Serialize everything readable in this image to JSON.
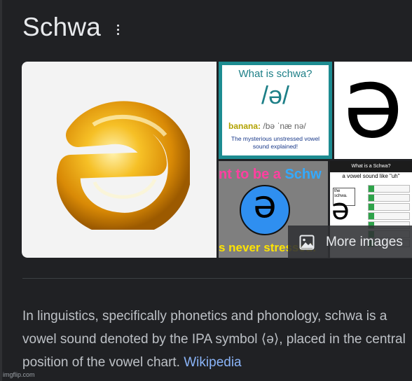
{
  "panel": {
    "title": "Schwa"
  },
  "gallery": {
    "thumb2": {
      "question": "What is schwa?",
      "symbol": "/ə/",
      "word": "banana:",
      "pron": "/bə ˈnæ nə/",
      "note_line1": "The mysterious unstressed vowel",
      "note_line2": "sound explained!"
    },
    "thumb3": {
      "symbol": "ə"
    },
    "thumb4": {
      "top_text": "nt to be a",
      "top_highlight": "Schw",
      "symbol": "ə",
      "bottom_text": "s never stressed."
    },
    "thumb5": {
      "header": "What is a Schwa?",
      "subheader": "a vowel sound like \"uh\"",
      "box_text": "the schwa.",
      "symbol": "ə"
    },
    "main_symbol": "ə",
    "more_images_label": "More images"
  },
  "description": {
    "text": "In linguistics, specifically phonetics and phonology, schwa is a vowel sound denoted by the IPA symbol ⟨ə⟩, placed in the central position of the vowel chart.",
    "source_link": "Wikipedia"
  },
  "watermark": "imgflip.com",
  "colors": {
    "background": "#202124",
    "text": "#bdc1c6",
    "title": "#e8eaed",
    "link": "#8ab4f8"
  }
}
